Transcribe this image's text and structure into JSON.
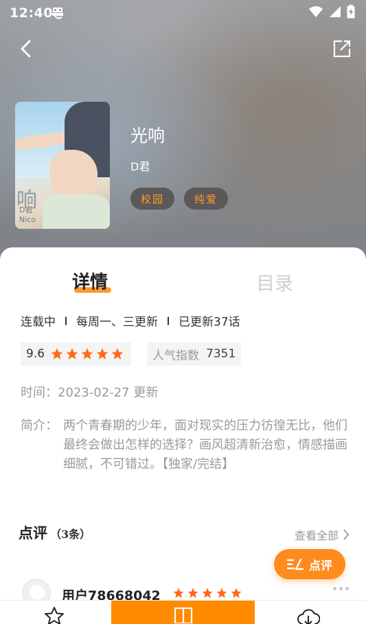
{
  "status_bar": {
    "time": "12:40"
  },
  "header": {
    "title": "光响",
    "author": "D君",
    "tags": [
      "校园",
      "纯爱"
    ]
  },
  "tabs": {
    "detail": "详情",
    "toc": "目录"
  },
  "meta": {
    "status": "连载中",
    "schedule": "每周一、三更新",
    "episodes": "已更新37话"
  },
  "rating": {
    "score": "9.6",
    "stars": 5
  },
  "popularity": {
    "label": "人气指数",
    "value": "7351"
  },
  "time": {
    "label": "时间：",
    "value": "2023-02-27 更新"
  },
  "intro": {
    "label": "简介：",
    "text": "两个青春期的少年，面对现实的压力彷徨无比，他们最终会做出怎样的选择？画风超清新治愈，情感描画细腻，不可错过。【独家/完结】"
  },
  "reviews": {
    "title": "点评",
    "count": "（3条）",
    "view_all": "查看全部",
    "comment_button": "点评",
    "items": [
      {
        "user": "用户78668042",
        "stars": 5
      }
    ]
  },
  "colors": {
    "accent": "#ff8a00",
    "star": "#ff6a1a",
    "tag_text": "#ff9a2e"
  }
}
